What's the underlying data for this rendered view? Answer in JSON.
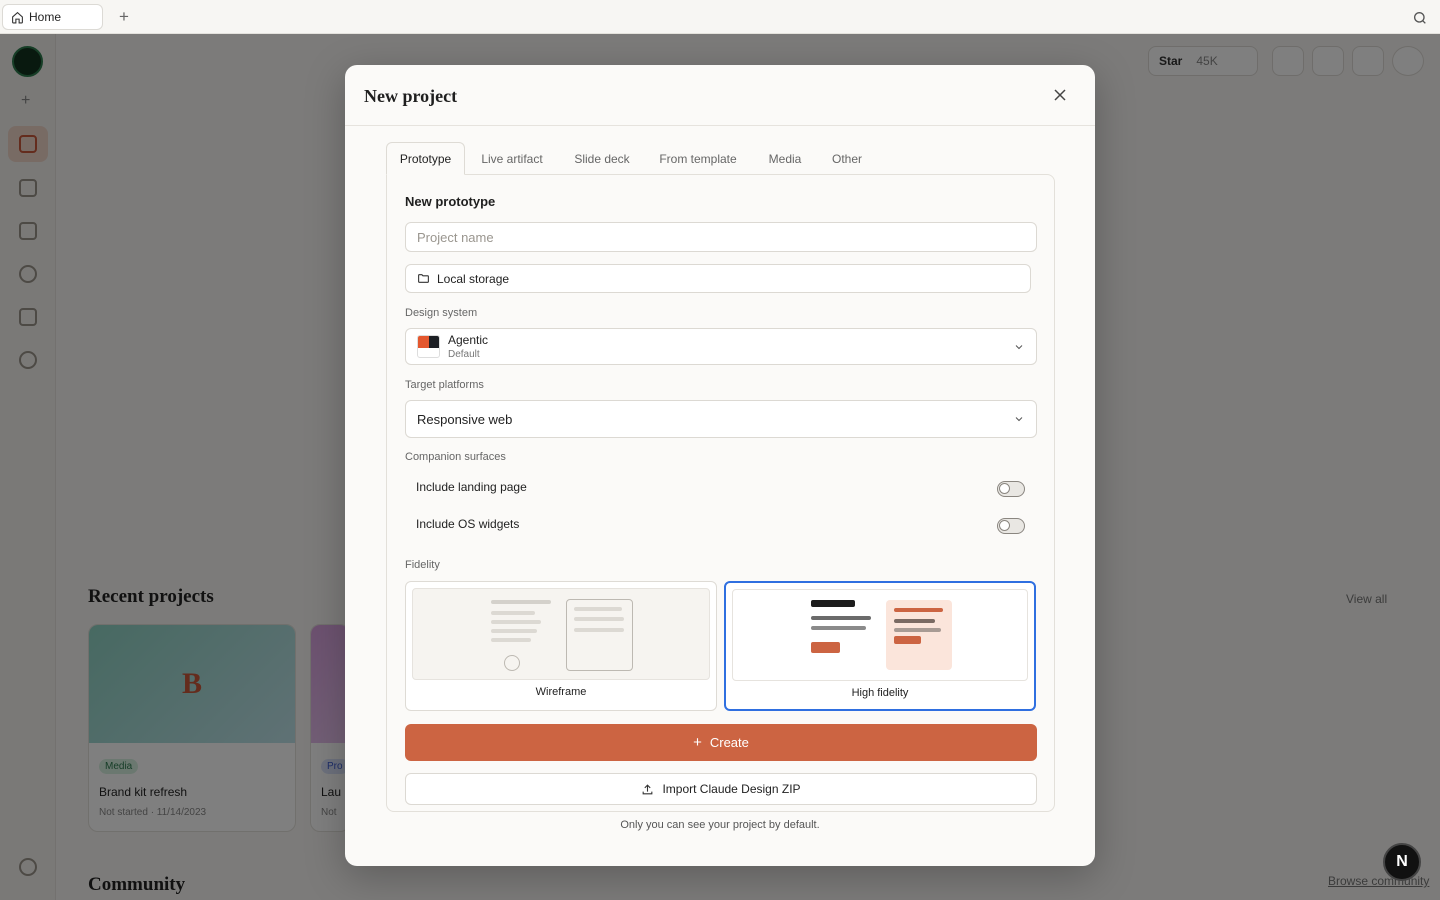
{
  "browser": {
    "tab_label": "Home",
    "new_tab_label": "+"
  },
  "background": {
    "star_label": "Star",
    "star_count": "45K",
    "recent_title": "Recent projects",
    "view_all": "View all",
    "community_title": "Community",
    "browse_link": "Browse community",
    "cards": [
      {
        "thumb_letter": "B",
        "badge": "Media",
        "title": "Brand kit refresh",
        "meta": "Not started · 11/14/2023"
      },
      {
        "thumb_letter": "",
        "badge": "Pro",
        "title": "Lau",
        "meta": "Not"
      }
    ]
  },
  "modal": {
    "title": "New project",
    "tabs": [
      {
        "label": "Prototype",
        "active": true
      },
      {
        "label": "Live artifact"
      },
      {
        "label": "Slide deck"
      },
      {
        "label": "From template"
      },
      {
        "label": "Media"
      },
      {
        "label": "Other"
      }
    ],
    "section_title": "New prototype",
    "project_name": {
      "placeholder": "Project name",
      "value": ""
    },
    "storage_label": "Local storage",
    "design_system": {
      "label": "Design system",
      "name": "Agentic",
      "sub": "Default"
    },
    "target_platforms": {
      "label": "Target platforms",
      "value": "Responsive web"
    },
    "companion": {
      "label": "Companion surfaces",
      "landing": {
        "label": "Include landing page",
        "enabled": false
      },
      "widgets": {
        "label": "Include OS widgets",
        "enabled": false
      }
    },
    "fidelity": {
      "label": "Fidelity",
      "options": [
        {
          "label": "Wireframe",
          "selected": false
        },
        {
          "label": "High fidelity",
          "selected": true
        }
      ]
    },
    "create_label": "Create",
    "import_label": "Import Claude Design ZIP",
    "footnote": "Only you can see your project by default."
  },
  "badge_letter": "N",
  "colors": {
    "accent": "#cc6442",
    "selected_border": "#2f6fe0"
  }
}
